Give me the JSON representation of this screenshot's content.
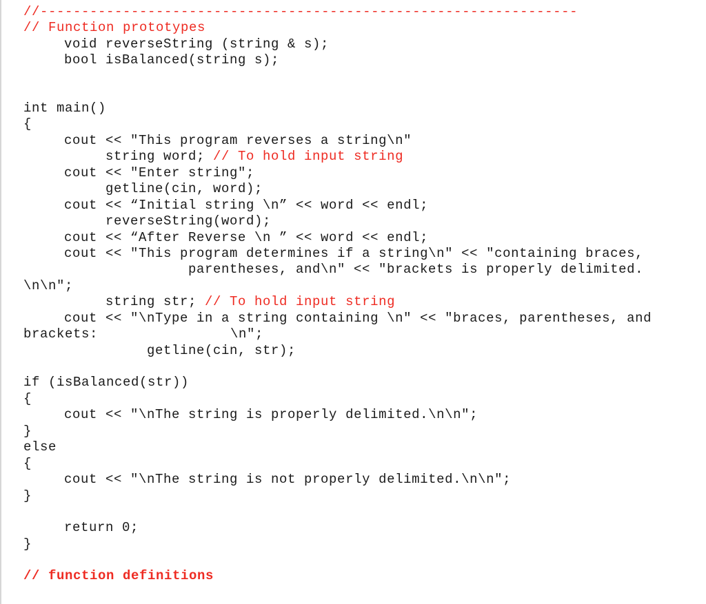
{
  "colors": {
    "comment": "#ee2b22",
    "code": "#1a1a1a",
    "border": "#d6d6d6"
  },
  "lines": [
    {
      "id": "divider",
      "code": "",
      "comment": "//-----------------------------------------------------------------"
    },
    {
      "id": "proto-comment",
      "code": "",
      "comment": "// Function prototypes"
    },
    {
      "id": "proto-reverse",
      "code": "void reverseString (string & s);",
      "comment": ""
    },
    {
      "id": "proto-balanced",
      "code": "bool isBalanced(string s);",
      "comment": ""
    },
    {
      "id": "main-sig",
      "code": "int main()",
      "comment": ""
    },
    {
      "id": "main-open",
      "code": "{",
      "comment": ""
    },
    {
      "id": "l1",
      "code": "cout << \"This program reverses a string\\n\"",
      "comment": ""
    },
    {
      "id": "l2",
      "code": "string word; ",
      "comment": "// To hold input string"
    },
    {
      "id": "l3",
      "code": "cout << \"Enter string\";",
      "comment": ""
    },
    {
      "id": "l4",
      "code": "getline(cin, word);",
      "comment": ""
    },
    {
      "id": "l5",
      "code": "cout << “Initial string \\n” << word << endl;",
      "comment": ""
    },
    {
      "id": "l6",
      "code": "reverseString(word);",
      "comment": ""
    },
    {
      "id": "l7",
      "code": "cout << “After Reverse \\n ” << word << endl;",
      "comment": ""
    },
    {
      "id": "l8",
      "code": "cout << \"This program determines if a string\\n\" << \"containing braces,",
      "comment": ""
    },
    {
      "id": "l9",
      "code": "parentheses, and\\n\" << \"brackets is properly delimited.",
      "comment": ""
    },
    {
      "id": "l10",
      "code": "\\n\\n\";",
      "comment": ""
    },
    {
      "id": "l11",
      "code": "string str; ",
      "comment": "// To hold input string"
    },
    {
      "id": "l12",
      "code": "cout << \"\\nType in a string containing \\n\" << \"braces, parentheses, and",
      "comment": ""
    },
    {
      "id": "l13",
      "code": "brackets:                \\n\";",
      "comment": ""
    },
    {
      "id": "l14",
      "code": "getline(cin, str);",
      "comment": ""
    },
    {
      "id": "if",
      "code": "if (isBalanced(str))",
      "comment": ""
    },
    {
      "id": "if-open",
      "code": "{",
      "comment": ""
    },
    {
      "id": "if-body",
      "code": "cout << \"\\nThe string is properly delimited.\\n\\n\";",
      "comment": ""
    },
    {
      "id": "if-close",
      "code": "}",
      "comment": ""
    },
    {
      "id": "else",
      "code": "else",
      "comment": ""
    },
    {
      "id": "else-open",
      "code": "{",
      "comment": ""
    },
    {
      "id": "else-body",
      "code": "cout << \"\\nThe string is not properly delimited.\\n\\n\";",
      "comment": ""
    },
    {
      "id": "else-close",
      "code": "}",
      "comment": ""
    },
    {
      "id": "return",
      "code": "return 0;",
      "comment": ""
    },
    {
      "id": "main-close",
      "code": "}",
      "comment": ""
    },
    {
      "id": "defs-comment",
      "code": "",
      "comment": "// function definitions"
    }
  ]
}
